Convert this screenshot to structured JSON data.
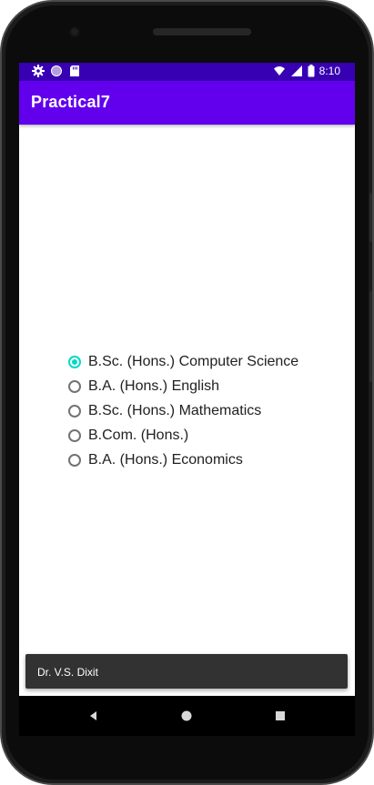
{
  "status_bar": {
    "time": "8:10",
    "left_icons": [
      "gear-icon",
      "circle-icon",
      "sd-card-icon"
    ],
    "right_icons": [
      "wifi-icon",
      "cellular-signal-icon",
      "battery-icon"
    ]
  },
  "app_bar": {
    "title": "Practical7"
  },
  "radio_group": {
    "selected_index": 0,
    "options": [
      "B.Sc. (Hons.) Computer Science",
      "B.A. (Hons.) English",
      "B.Sc. (Hons.) Mathematics",
      "B.Com. (Hons.)",
      "B.A. (Hons.) Economics"
    ]
  },
  "toast": {
    "message": "Dr. V.S. Dixit"
  },
  "nav_bar": {
    "buttons": [
      "back-icon",
      "home-icon",
      "recents-icon"
    ]
  },
  "colors": {
    "status_bar": "#3700b3",
    "app_bar": "#6200ee",
    "accent": "#03dac5",
    "toast": "#323232"
  }
}
